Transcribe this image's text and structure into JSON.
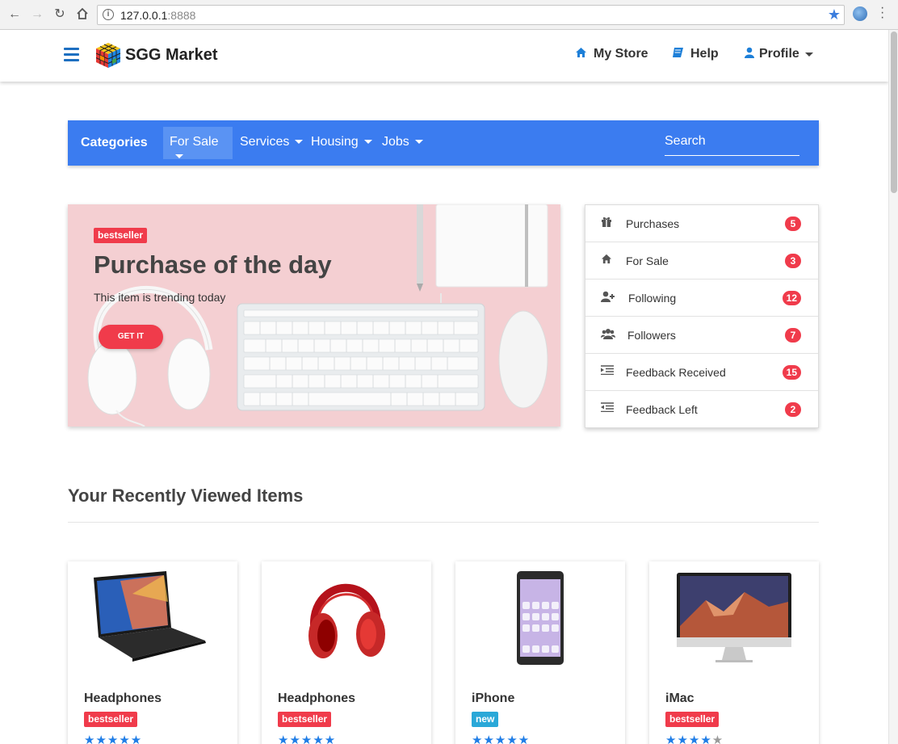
{
  "browser": {
    "url_host": "127.0.0.1",
    "url_port": ":8888"
  },
  "header": {
    "brand": "SGG Market",
    "nav": [
      {
        "label": "My Store",
        "icon": "home-icon"
      },
      {
        "label": "Help",
        "icon": "book-icon"
      },
      {
        "label": "Profile",
        "icon": "user-icon"
      }
    ]
  },
  "categories": {
    "title": "Categories",
    "items": [
      {
        "label": "For Sale",
        "active": true
      },
      {
        "label": "Services"
      },
      {
        "label": "Housing"
      },
      {
        "label": "Jobs"
      }
    ],
    "search_placeholder": "Search"
  },
  "hero": {
    "badge": "bestseller",
    "title": "Purchase of the day",
    "subtitle": "This item is trending today",
    "cta": "GET IT"
  },
  "sidelist": [
    {
      "label": "Purchases",
      "count": "5",
      "icon": "gift-icon"
    },
    {
      "label": "For Sale",
      "count": "3",
      "icon": "home-icon"
    },
    {
      "label": "Following",
      "count": "12",
      "icon": "user-plus-icon"
    },
    {
      "label": "Followers",
      "count": "7",
      "icon": "users-icon"
    },
    {
      "label": "Feedback Received",
      "count": "15",
      "icon": "indent-icon"
    },
    {
      "label": "Feedback Left",
      "count": "2",
      "icon": "outdent-icon"
    }
  ],
  "recent": {
    "title": "Your Recently Viewed Items",
    "items": [
      {
        "name": "Headphones",
        "badge": "bestseller",
        "badge_type": "bestseller",
        "rating": 5
      },
      {
        "name": "Headphones",
        "badge": "bestseller",
        "badge_type": "bestseller",
        "rating": 5
      },
      {
        "name": "iPhone",
        "badge": "new",
        "badge_type": "new",
        "rating": 5
      },
      {
        "name": "iMac",
        "badge": "bestseller",
        "badge_type": "bestseller",
        "rating": 4
      }
    ]
  },
  "colors": {
    "primary": "#3b7cf0",
    "danger": "#f03b4b",
    "info": "#2aa8d8",
    "hero_bg": "#f4cfd2"
  }
}
